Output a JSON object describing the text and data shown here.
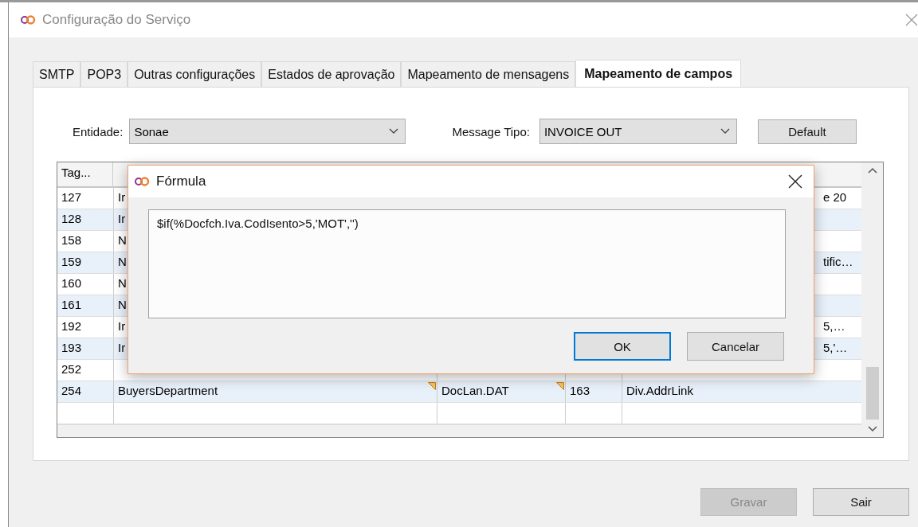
{
  "window": {
    "title": "Configuração do Serviço"
  },
  "tabs": [
    {
      "label": "SMTP",
      "selected": false
    },
    {
      "label": "POP3",
      "selected": false
    },
    {
      "label": "Outras configurações",
      "selected": false
    },
    {
      "label": "Estados de aprovação",
      "selected": false
    },
    {
      "label": "Mapeamento de mensagens",
      "selected": false
    },
    {
      "label": "Mapeamento de campos",
      "selected": true
    }
  ],
  "filters": [
    {
      "label": "Entidade:",
      "value": "Sonae"
    },
    {
      "label": "Message Tipo:",
      "value": "INVOICE OUT"
    }
  ],
  "default_button": "Default",
  "table": {
    "columns": [
      "Tag..."
    ],
    "rows": [
      {
        "tag": "127",
        "name": "Ir",
        "source": "",
        "code": "",
        "field": "e 20",
        "flagged": false
      },
      {
        "tag": "128",
        "name": "Ir",
        "source": "",
        "code": "",
        "field": "",
        "flagged": false
      },
      {
        "tag": "158",
        "name": "N",
        "source": "",
        "code": "",
        "field": "",
        "flagged": false
      },
      {
        "tag": "159",
        "name": "N",
        "source": "",
        "code": "",
        "field": "tific…",
        "flagged": false
      },
      {
        "tag": "160",
        "name": "N",
        "source": "",
        "code": "",
        "field": "",
        "flagged": false
      },
      {
        "tag": "161",
        "name": "N",
        "source": "",
        "code": "",
        "field": "",
        "flagged": false
      },
      {
        "tag": "192",
        "name": "Ir",
        "source": "",
        "code": "",
        "field": "5,…",
        "flagged": false
      },
      {
        "tag": "193",
        "name": "Ir",
        "source": "",
        "code": "",
        "field": "5,'…",
        "flagged": false
      },
      {
        "tag": "252",
        "name": "",
        "source": "",
        "code": "",
        "field": "",
        "flagged": false
      },
      {
        "tag": "254",
        "name": "BuyersDepartment",
        "source": "DocLan.DAT",
        "code": "163",
        "field": "Div.AddrLink",
        "flagged": true
      }
    ]
  },
  "buttons": [
    {
      "label": "Gravar",
      "disabled": true
    },
    {
      "label": "Sair",
      "disabled": false
    }
  ],
  "dialog": {
    "title": "Fórmula",
    "formula": "$if(%Docfch.Iva.CodIsento>5,'MOT','')",
    "buttons": [
      {
        "label": "OK",
        "focused": true
      },
      {
        "label": "Cancelar",
        "focused": false
      }
    ]
  }
}
